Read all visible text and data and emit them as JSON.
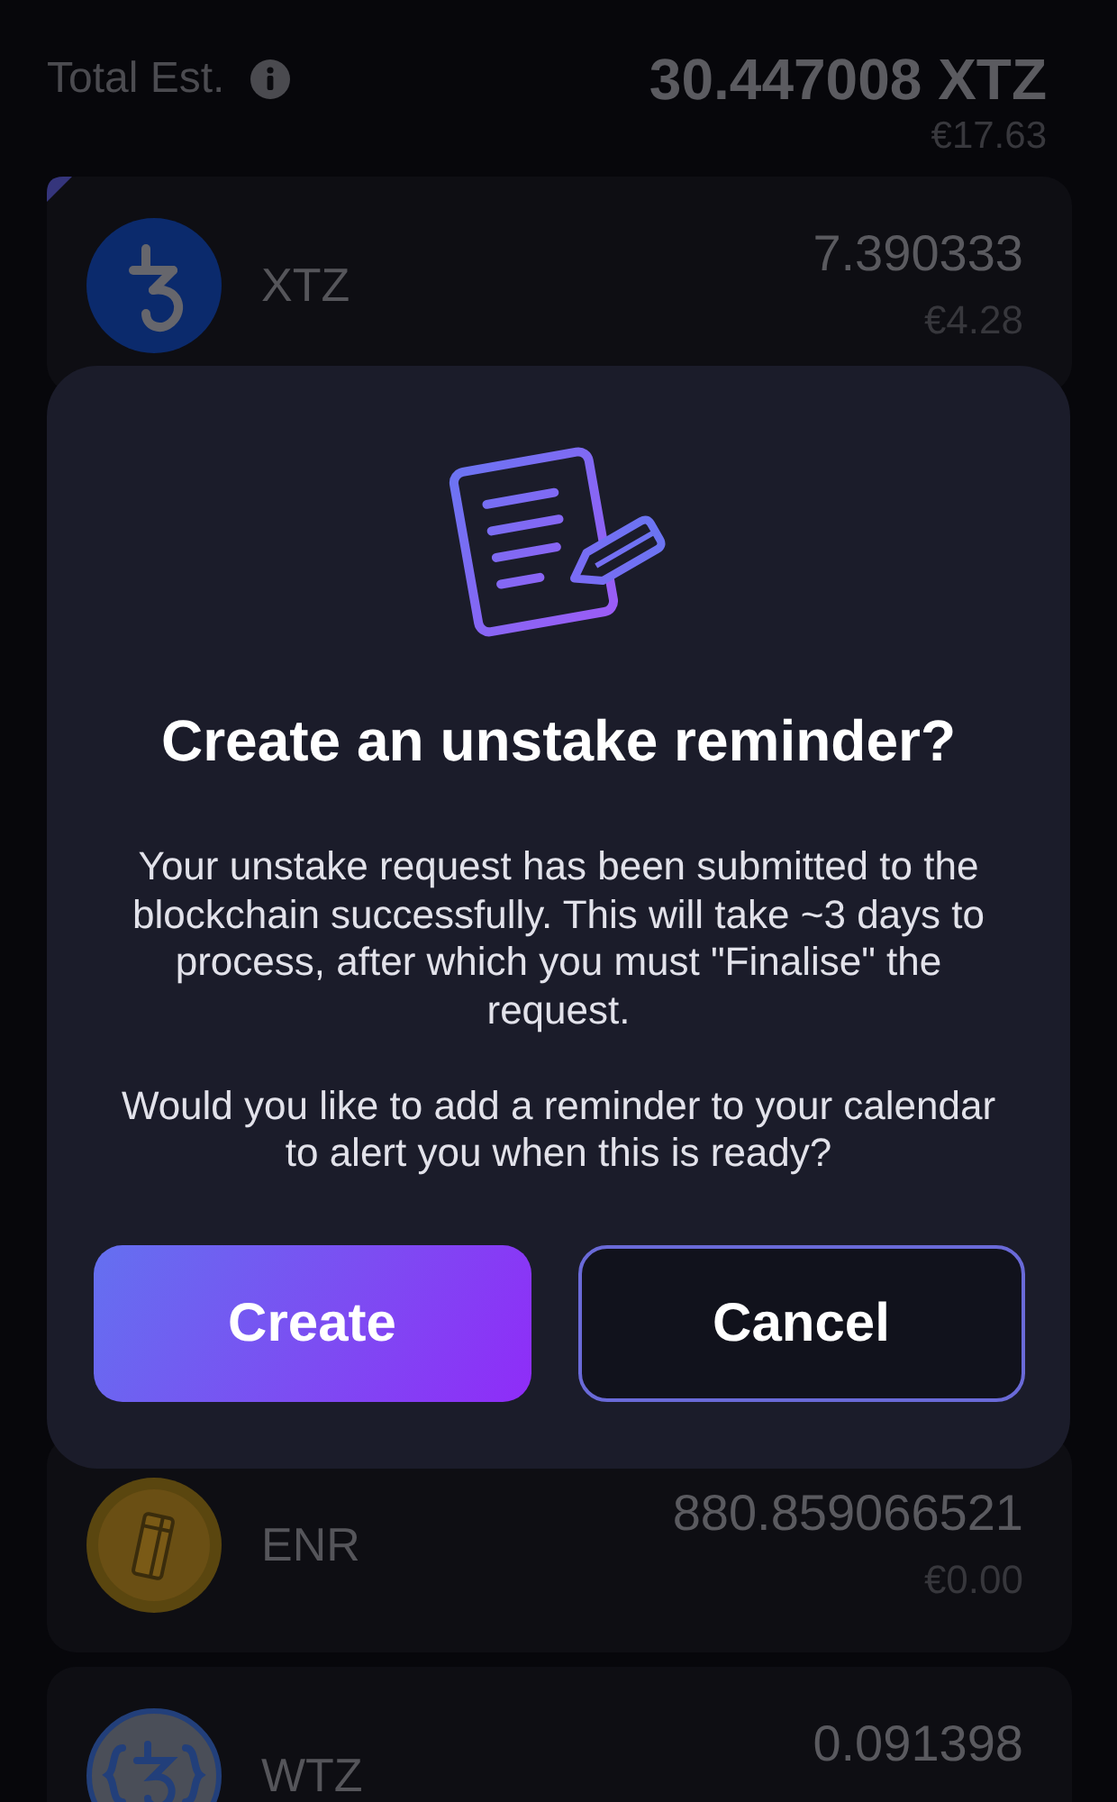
{
  "header": {
    "label": "Total Est.",
    "total": "30.447008 XTZ",
    "fiat": "€17.63"
  },
  "tokens": [
    {
      "kind": "tezos",
      "symbol": "XTZ",
      "amount": "7.390333",
      "fiat": "€4.28",
      "highlighted": true
    },
    {
      "kind": "enr",
      "symbol": "ENR",
      "amount": "880.859066521",
      "fiat": "€0.00",
      "highlighted": false
    },
    {
      "kind": "wtz",
      "symbol": "WTZ",
      "amount": "0.091398",
      "highlighted": false
    }
  ],
  "dialog": {
    "title": "Create an unstake reminder?",
    "paragraphs": [
      "Your unstake request has been submitted to the blockchain successfully. This will take ~3 days to process, after which you must \"Finalise\" the request.",
      "Would you like to add a reminder to your calendar to alert you when this is ready?"
    ],
    "buttons": [
      {
        "kind": "primary",
        "label": "Create"
      },
      {
        "kind": "secondary",
        "label": "Cancel"
      }
    ]
  }
}
